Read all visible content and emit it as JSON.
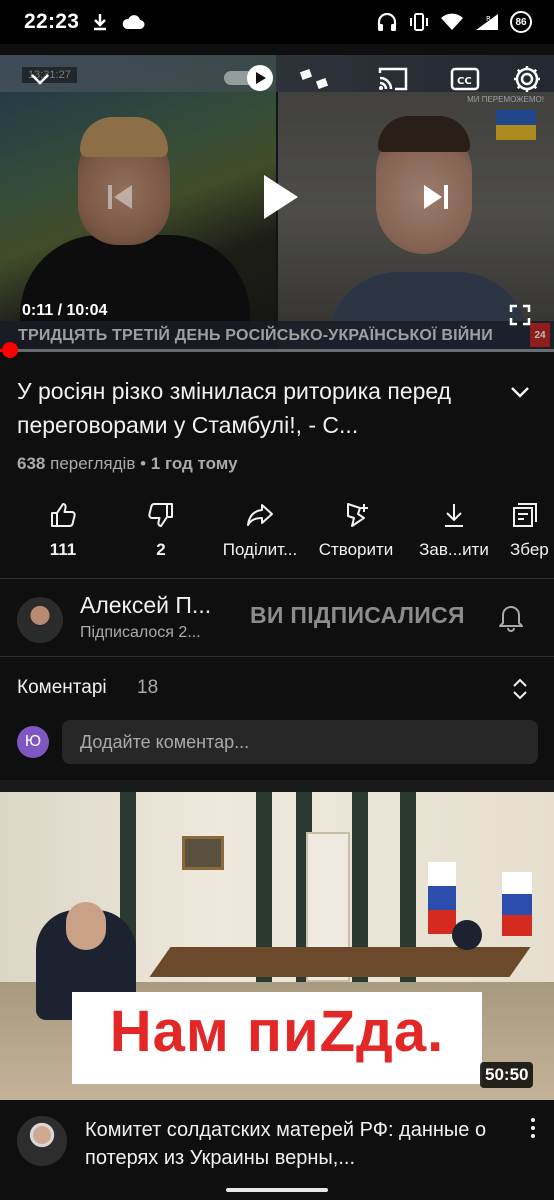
{
  "status_bar": {
    "time": "22:23",
    "battery_level": "86",
    "icons": [
      "download-icon",
      "cloud-icon",
      "headphones-icon",
      "vibrate-icon",
      "wifi-icon",
      "signal-icon"
    ]
  },
  "player": {
    "current_time": "0:11",
    "duration": "10:04",
    "time_display": "0:11 / 10:04",
    "progress": 0.018,
    "video_overlay": {
      "timecode": "13:31:27",
      "slogan": "МИ ПЕРЕМОЖЕМО!",
      "banner_text": "ТРИДЦЯТЬ ТРЕТІЙ ДЕНЬ РОСІЙСЬКО-УКРАЇНСЬКОЇ ВІЙНИ",
      "channel_logo": "24"
    },
    "colors": {
      "progress": "#ff0000"
    }
  },
  "video": {
    "title": "У росіян різко змінилася риторика перед переговорами у Стамбулі!, - С...",
    "views_count": "638",
    "views_label": "переглядів",
    "separator": "•",
    "uploaded": "1 год тому"
  },
  "actions": [
    {
      "name": "like-button",
      "icon": "thumb-up-icon",
      "label": "111"
    },
    {
      "name": "dislike-button",
      "icon": "thumb-down-icon",
      "label": "2"
    },
    {
      "name": "share-button",
      "icon": "share-icon",
      "label": "Поділит..."
    },
    {
      "name": "create-button",
      "icon": "create-icon",
      "label": "Створити"
    },
    {
      "name": "download-button",
      "icon": "download-icon",
      "label": "Зав...ити"
    },
    {
      "name": "save-button",
      "icon": "save-icon",
      "label": "Збер"
    }
  ],
  "channel": {
    "name": "Алексей П...",
    "subscribers": "Підписалося 2...",
    "subscribe_state": "ВИ ПІДПИСАЛИСЯ"
  },
  "comments": {
    "title": "Коментарі",
    "count": "18",
    "user_initial": "Ю",
    "input_placeholder": "Додайте коментар..."
  },
  "next_video": {
    "thumbnail_caption": "Нам пиZда.",
    "duration": "50:50",
    "title": "Комитет солдатских матерей РФ: данные о потерях из Украины верны,..."
  }
}
